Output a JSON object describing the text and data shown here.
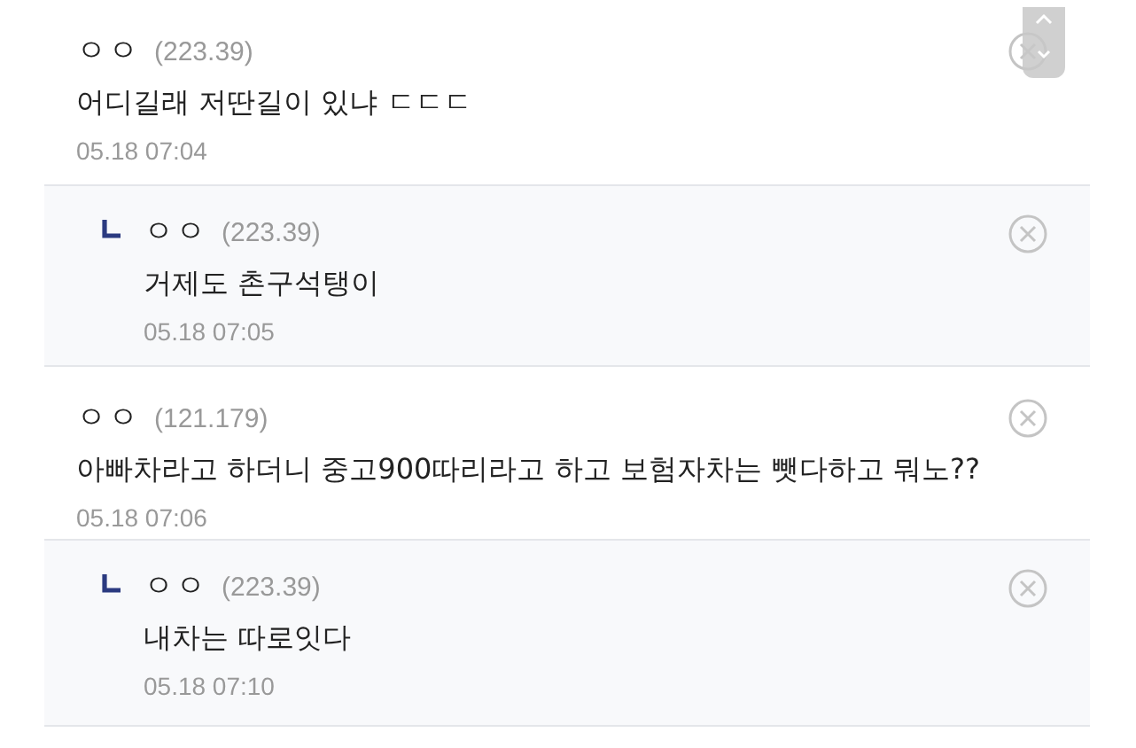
{
  "comments": [
    {
      "kind": "comment",
      "author": "ㅇㅇ",
      "ip": "(223.39)",
      "text": "어디길래 저딴길이 있냐 ㄷㄷㄷ",
      "time": "05.18 07:04"
    },
    {
      "kind": "reply",
      "author": "ㅇㅇ",
      "ip": "(223.39)",
      "text": "거제도 촌구석탱이",
      "time": "05.18 07:05"
    },
    {
      "kind": "comment",
      "author": "ㅇㅇ",
      "ip": "(121.179)",
      "text": "아빠차라고 하더니 중고900따리라고 하고 보험자차는 뺏다하고 뭐노??",
      "time": "05.18 07:06"
    },
    {
      "kind": "reply",
      "author": "ㅇㅇ",
      "ip": "(223.39)",
      "text": "내차는 따로잇다",
      "time": "05.18 07:10"
    }
  ]
}
